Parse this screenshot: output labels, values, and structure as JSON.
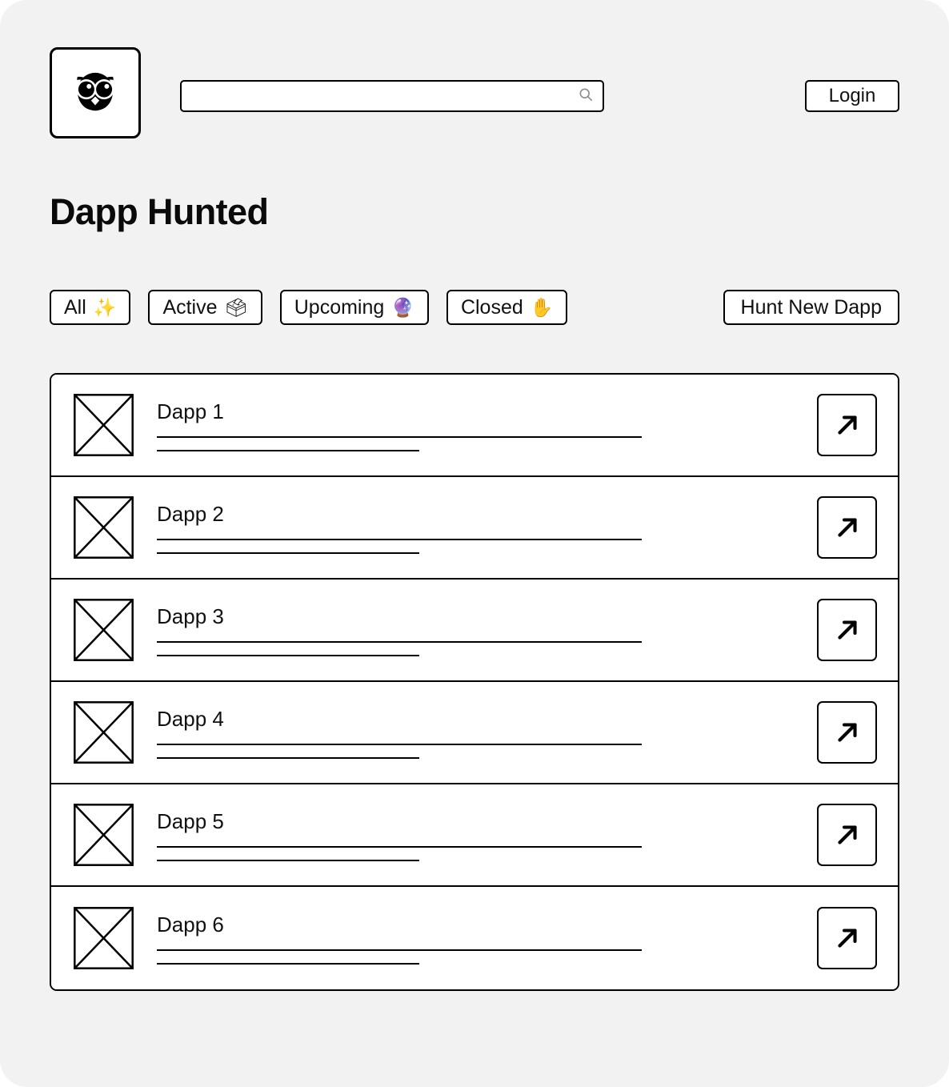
{
  "header": {
    "logo_icon": "owl-logo-icon",
    "search": {
      "value": "",
      "placeholder": "",
      "icon": "search-icon"
    },
    "login_label": "Login"
  },
  "page_title": "Dapp Hunted",
  "filters": [
    {
      "label": "All",
      "emoji": "✨"
    },
    {
      "label": "Active",
      "emoji": "🗳"
    },
    {
      "label": "Upcoming",
      "emoji": "🔮"
    },
    {
      "label": "Closed",
      "emoji": "✋"
    }
  ],
  "hunt_button_label": "Hunt New Dapp",
  "list": {
    "rows": [
      {
        "title": "Dapp 1",
        "thumb_icon": "image-placeholder-icon",
        "open_icon": "arrow-up-right-icon"
      },
      {
        "title": "Dapp 2",
        "thumb_icon": "image-placeholder-icon",
        "open_icon": "arrow-up-right-icon"
      },
      {
        "title": "Dapp 3",
        "thumb_icon": "image-placeholder-icon",
        "open_icon": "arrow-up-right-icon"
      },
      {
        "title": "Dapp 4",
        "thumb_icon": "image-placeholder-icon",
        "open_icon": "arrow-up-right-icon"
      },
      {
        "title": "Dapp 5",
        "thumb_icon": "image-placeholder-icon",
        "open_icon": "arrow-up-right-icon"
      },
      {
        "title": "Dapp 6",
        "thumb_icon": "image-placeholder-icon",
        "open_icon": "arrow-up-right-icon"
      }
    ]
  },
  "colors": {
    "page_background": "#f2f2f2",
    "surface": "#ffffff",
    "stroke": "#000000",
    "text": "#111111",
    "search_icon": "#8c8c8c"
  }
}
